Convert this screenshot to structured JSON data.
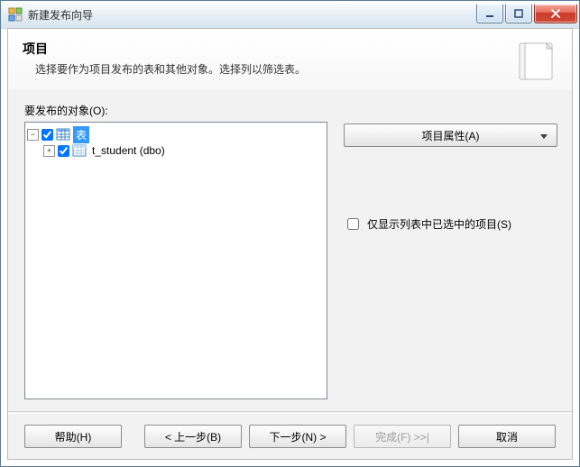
{
  "window": {
    "title": "新建发布向导"
  },
  "header": {
    "title": "项目",
    "subtitle": "选择要作为项目发布的表和其他对象。选择列以筛选表。"
  },
  "section_label": "要发布的对象(O):",
  "tree": {
    "root": {
      "label": "表",
      "checked": true,
      "expanded": true,
      "selected": true
    },
    "child": {
      "label": "t_student (dbo)",
      "checked": true,
      "expanded": false
    }
  },
  "right": {
    "properties_btn": "项目属性(A)",
    "selected_only_label": "仅显示列表中已选中的项目(S)"
  },
  "footer": {
    "help": "帮助(H)",
    "back": "< 上一步(B)",
    "next": "下一步(N) >",
    "finish": "完成(F) >>|",
    "cancel": "取消"
  }
}
